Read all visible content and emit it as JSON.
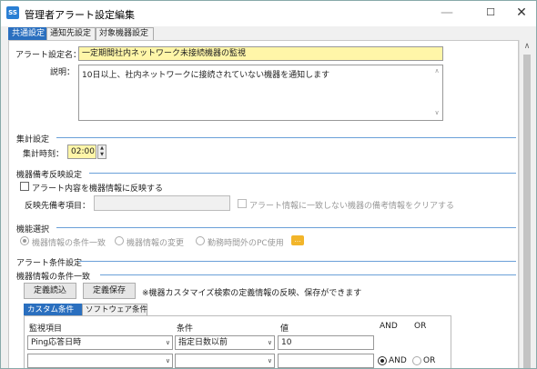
{
  "window": {
    "app_icon": "SS",
    "title": "管理者アラート設定編集",
    "minimize": "—",
    "maximize": "☐",
    "close": "✕"
  },
  "tabs": [
    {
      "label": "共通設定",
      "active": true
    },
    {
      "label": "通知先設定",
      "active": false
    },
    {
      "label": "対象機器設定",
      "active": false
    }
  ],
  "alert": {
    "name_label": "アラート設定名：",
    "name_value": "一定期間社内ネットワーク未接続機器の監視",
    "desc_label": "説明：",
    "desc_value": "10日以上、社内ネットワークに接続されていない機器を通知します"
  },
  "aggregate": {
    "section": "集計設定",
    "time_label": "集計時刻：",
    "time_value": "02:00"
  },
  "reflect": {
    "section": "機器備考反映設定",
    "checkbox_label": "アラート内容を機器情報に反映する",
    "target_label": "反映先備考項目：",
    "clear_label": "アラート情報に一致しない機器の備考情報をクリアする"
  },
  "function": {
    "section": "機能選択",
    "options": [
      "機器情報の条件一致",
      "機器情報の変更",
      "勤務時間外のPC使用"
    ]
  },
  "condition": {
    "section": "アラート条件設定",
    "subsection": "機器情報の条件一致",
    "load_button": "定義読込",
    "save_button": "定義保存",
    "note": "※機器カスタマイズ検索の定義情報の反映、保存ができます",
    "subtabs": [
      {
        "label": "カスタム条件",
        "active": true
      },
      {
        "label": "ソフトウェア条件",
        "active": false
      }
    ],
    "col_item": "監視項目",
    "col_cond": "条件",
    "col_value": "値",
    "col_and": "AND",
    "col_or": "OR",
    "rows": [
      {
        "item": "Ping応答日時",
        "cond": "指定日数以前",
        "value": "10"
      },
      {
        "item": "",
        "cond": "",
        "value": ""
      }
    ],
    "and_label": "AND",
    "or_label": "OR"
  },
  "colors": {
    "accent": "#2a6fbf",
    "highlight": "#fff6a8",
    "section_line": "#6aa0d8"
  }
}
